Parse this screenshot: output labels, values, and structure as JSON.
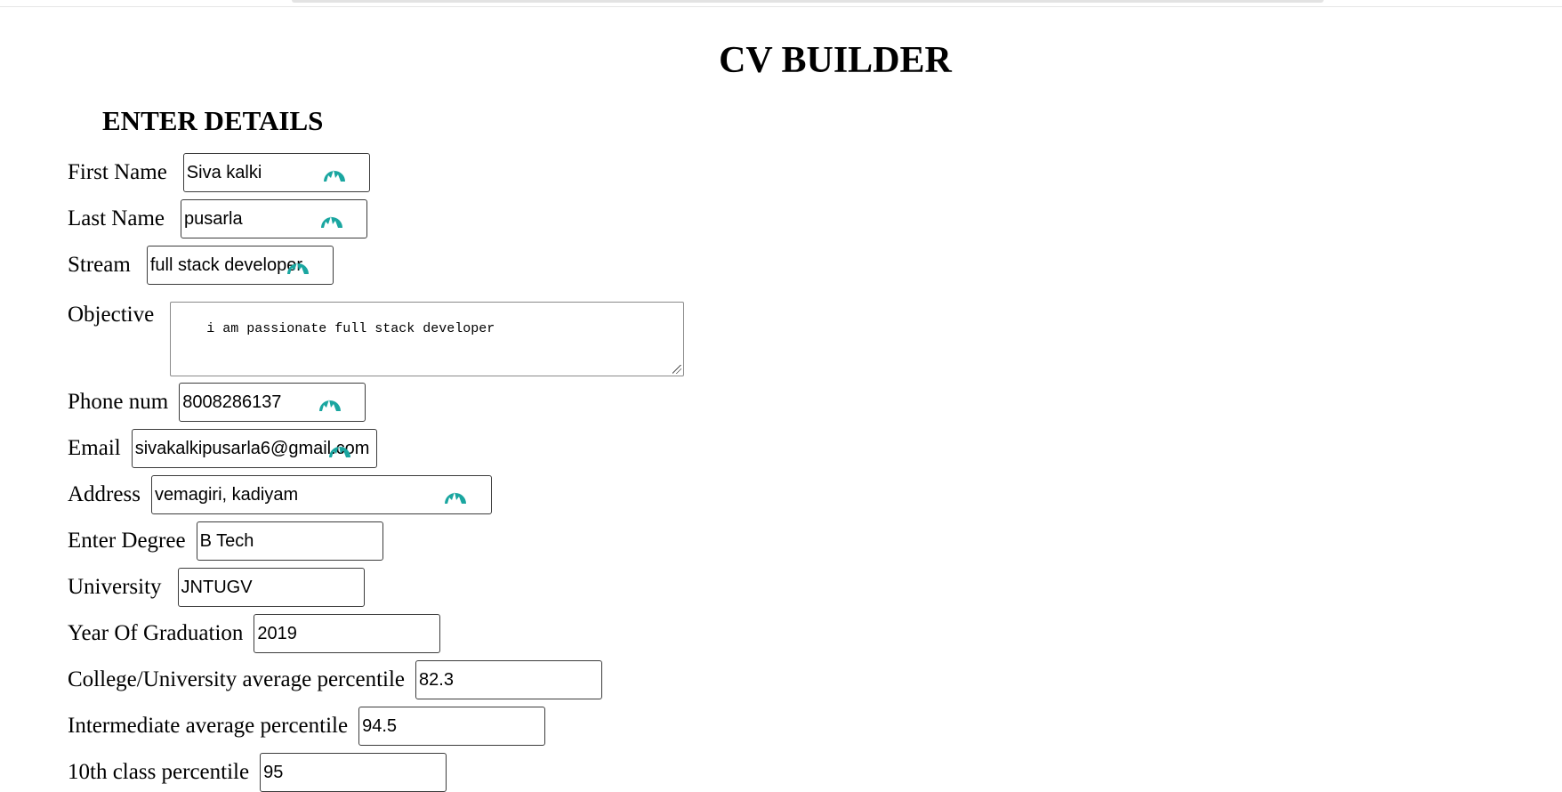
{
  "page": {
    "title": "CV BUILDER",
    "section_heading": "ENTER DETAILS"
  },
  "form": {
    "first_name": {
      "label": "First Name",
      "value": "Siva kalki"
    },
    "last_name": {
      "label": "Last Name",
      "value": "pusarla"
    },
    "stream": {
      "label": "Stream",
      "value": "full stack developer"
    },
    "objective": {
      "label": "Objective",
      "value": "i am passionate full stack developer"
    },
    "phone": {
      "label": "Phone num",
      "value": "8008286137"
    },
    "email": {
      "label": "Email",
      "value": "sivakalkipusarla6@gmail.com"
    },
    "address": {
      "label": "Address",
      "value": "vemagiri, kadiyam"
    },
    "degree": {
      "label": "Enter Degree",
      "value": "B Tech"
    },
    "university": {
      "label": "University",
      "value": "JNTUGV"
    },
    "year_of_graduation": {
      "label": "Year Of Graduation",
      "value": "2019"
    },
    "college_percentile": {
      "label": "College/University average percentile",
      "value": "82.3"
    },
    "intermediate_percentile": {
      "label": "Intermediate average percentile",
      "value": "94.5"
    },
    "tenth_percentile": {
      "label": "10th class percentile",
      "value": "95"
    }
  },
  "icons": {
    "password_manager_icon": "password-manager-icon",
    "accent_color": "#1aa6a0"
  }
}
